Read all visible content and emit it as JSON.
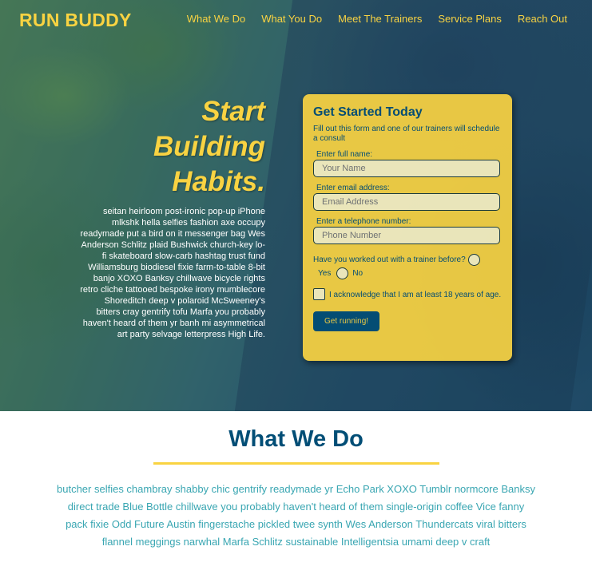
{
  "header": {
    "logo": "RUN BUDDY",
    "nav": [
      "What We Do",
      "What You Do",
      "Meet The Trainers",
      "Service Plans",
      "Reach Out"
    ]
  },
  "hero": {
    "title_lines": [
      "Start",
      "Building",
      "Habits."
    ],
    "body": "seitan heirloom post-ironic pop-up iPhone mlkshk hella selfies fashion axe occupy readymade put a bird on it messenger bag Wes Anderson Schlitz plaid Bushwick church-key lo-fi skateboard slow-carb hashtag trust fund Williamsburg biodiesel fixie farm-to-table 8-bit banjo XOXO Banksy chillwave bicycle rights retro cliche tattooed bespoke irony mumblecore Shoreditch deep v polaroid McSweeney's bitters cray gentrify tofu Marfa you probably haven't heard of them yr banh mi asymmetrical art party selvage letterpress High Life."
  },
  "form": {
    "title": "Get Started Today",
    "subtitle": "Fill out this form and one of our trainers will schedule a consult",
    "name_label": "Enter full name:",
    "name_placeholder": "Your Name",
    "email_label": "Enter email address:",
    "email_placeholder": "Email Address",
    "phone_label": "Enter a telephone number:",
    "phone_placeholder": "Phone Number",
    "trainer_question": "Have you worked out with a trainer before?",
    "yes_label": "Yes",
    "no_label": "No",
    "ack_label": "I acknowledge that I am at least 18 years of age.",
    "submit_label": "Get running!"
  },
  "what_we_do": {
    "title": "What We Do",
    "body": "butcher selfies chambray shabby chic gentrify readymade yr Echo Park XOXO Tumblr normcore Banksy direct trade Blue Bottle chillwave you probably haven't heard of them single-origin coffee Vice fanny pack fixie Odd Future Austin fingerstache pickled twee synth Wes Anderson Thundercats viral bitters flannel meggings narwhal Marfa Schlitz sustainable Intelligentsia umami deep v craft"
  },
  "colors": {
    "brand_yellow": "#f9d342",
    "brand_blue": "#024e76",
    "teal_text": "#39a6b2"
  }
}
